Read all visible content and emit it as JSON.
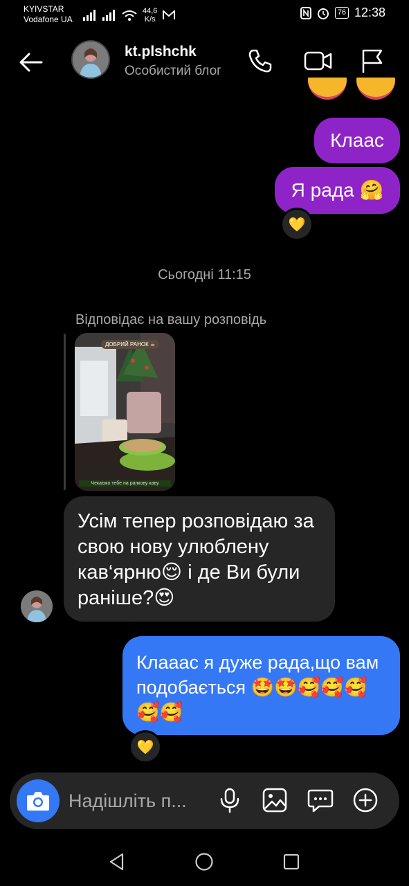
{
  "status_bar": {
    "carrier_1": "KYIVSTAR",
    "carrier_2": "Vodafone UA",
    "net_speed_value": "44,6",
    "net_speed_unit": "K/s",
    "battery": "76",
    "time": "12:38"
  },
  "header": {
    "username": "kt.plshchk",
    "subtitle": "Особистий блог"
  },
  "messages": {
    "out_1": "Клаас",
    "out_2": "Я рада 🤗",
    "out_2_reaction": "💛",
    "time_separator": "Сьогодні 11:15",
    "reply_note": "Відповідає на вашу розповідь",
    "story_badge": "ДОБРИЙ РАНОК ☕",
    "story_caption": "Чекаємо тебе на ранкову каву",
    "in_1": "Усім тепер розповідаю за свою нову улюблену кав‘ярню😌 і де Ви були раніше?😍",
    "out_3": "Клааас я дуже рада,що вам подобається 🤩🤩🥰🥰🥰🥰🥰",
    "out_3_reaction": "💛"
  },
  "composer": {
    "placeholder": "Надішліть п..."
  },
  "colors": {
    "outgoing_purple": "#8e24c8",
    "outgoing_blue": "#3478f6",
    "incoming_gray": "#262626",
    "background": "#000000"
  },
  "icons": [
    "back-arrow-icon",
    "phone-icon",
    "video-call-icon",
    "flag-icon",
    "camera-icon",
    "microphone-icon",
    "gallery-icon",
    "sticker-icon",
    "plus-icon",
    "nav-back-icon",
    "nav-home-icon",
    "nav-recents-icon"
  ]
}
